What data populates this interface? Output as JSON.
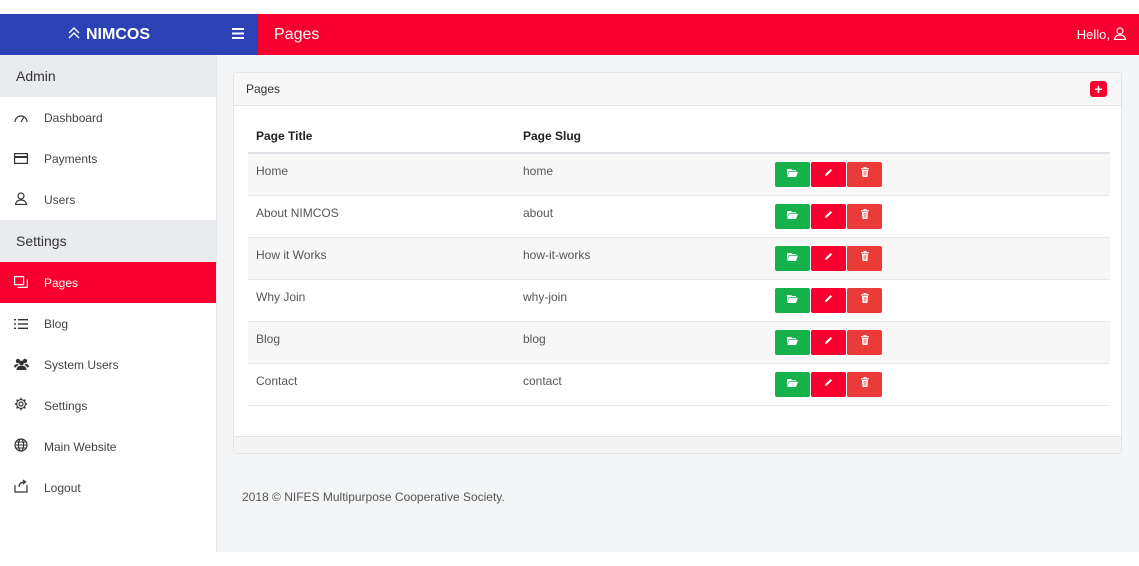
{
  "brand": {
    "name": "NIMCOS",
    "icon": "double-chevron-up-icon"
  },
  "header": {
    "title": "Pages",
    "hello": "Hello,",
    "menu_icon": "hamburger-icon",
    "user_icon": "user-icon"
  },
  "sidebar": {
    "sections": [
      {
        "label": "Admin",
        "items": [
          {
            "label": "Dashboard",
            "icon": "dashboard-icon"
          },
          {
            "label": "Payments",
            "icon": "credit-card-icon"
          },
          {
            "label": "Users",
            "icon": "user-icon"
          }
        ]
      },
      {
        "label": "Settings",
        "items": [
          {
            "label": "Pages",
            "icon": "pages-icon",
            "active": true
          },
          {
            "label": "Blog",
            "icon": "list-icon"
          },
          {
            "label": "System Users",
            "icon": "users-group-icon"
          },
          {
            "label": "Settings",
            "icon": "gear-icon"
          },
          {
            "label": "Main Website",
            "icon": "globe-icon"
          },
          {
            "label": "Logout",
            "icon": "logout-icon"
          }
        ]
      }
    ]
  },
  "card": {
    "title": "Pages",
    "add_icon": "plus-icon",
    "columns": [
      "Page Title",
      "Page Slug",
      ""
    ],
    "rows": [
      {
        "title": "Home",
        "slug": "home"
      },
      {
        "title": "About NIMCOS",
        "slug": "about"
      },
      {
        "title": "How it Works",
        "slug": "how-it-works"
      },
      {
        "title": "Why Join",
        "slug": "why-join"
      },
      {
        "title": "Blog",
        "slug": "blog"
      },
      {
        "title": "Contact",
        "slug": "contact"
      }
    ],
    "actions": {
      "view_icon": "folder-open-icon",
      "edit_icon": "pencil-icon",
      "delete_icon": "trash-icon"
    }
  },
  "colors": {
    "brand_blue": "#2c41b3",
    "accent_red": "#f7002f",
    "view_green": "#16b14a",
    "delete_red": "#ea3b38"
  },
  "footer": {
    "text": "2018 © NIFES Multipurpose Cooperative Society."
  }
}
